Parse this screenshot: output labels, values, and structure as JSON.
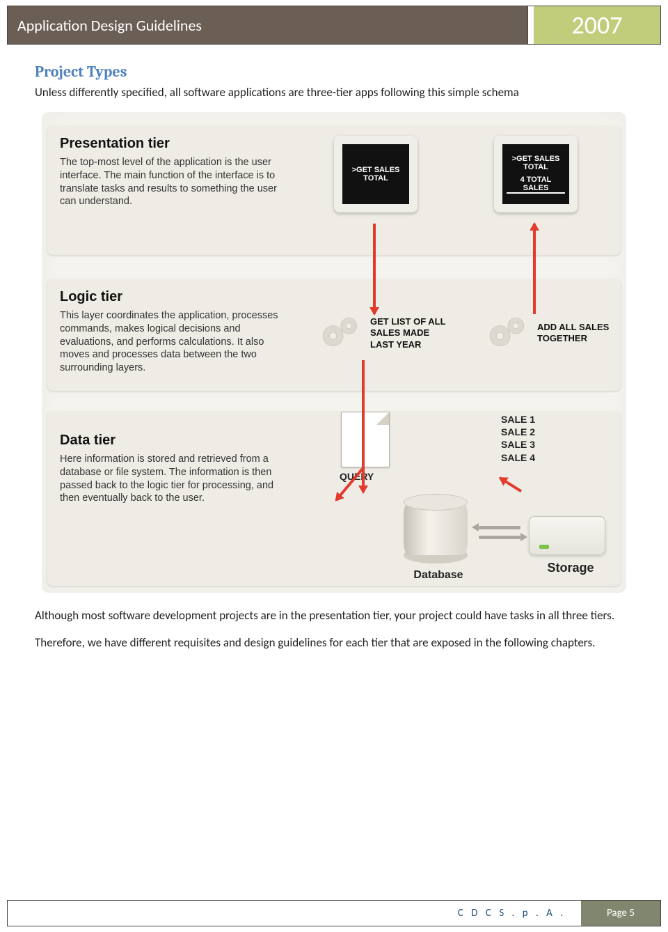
{
  "header": {
    "title": "Application Design Guidelines",
    "year": "2007"
  },
  "section": {
    "title": "Project Types",
    "intro": "Unless differently specified, all software applications are three-tier apps following this simple schema",
    "para2": "Although most software development projects are in the presentation tier, your project could have tasks in all three tiers.",
    "para3": "Therefore, we have different requisites and design guidelines for each tier that are exposed in the following chapters."
  },
  "diagram": {
    "presentation": {
      "title": "Presentation tier",
      "body": "The top-most level of the application is the user interface. The main function of the interface is to translate tasks and results to something the user can understand.",
      "screen1": ">GET SALES TOTAL",
      "screen2a": ">GET SALES TOTAL",
      "screen2b": "4 TOTAL SALES"
    },
    "logic": {
      "title": "Logic tier",
      "body": "This layer coordinates the application, processes commands, makes logical decisions and evaluations, and performs calculations. It also moves and processes data between the two surrounding layers.",
      "gear_left": "GET LIST OF ALL SALES MADE LAST YEAR",
      "gear_right": "ADD ALL SALES TOGETHER"
    },
    "data": {
      "title": "Data tier",
      "body": "Here information is stored and retrieved from a database or file system. The information is then passed back to the logic tier for processing, and then eventually back to the user.",
      "query_label": "QUERY",
      "sales": [
        "SALE 1",
        "SALE 2",
        "SALE 3",
        "SALE 4"
      ],
      "db_label": "Database",
      "storage_label": "Storage"
    }
  },
  "footer": {
    "company": "C D C   S . p . A .",
    "page": "Page 5"
  }
}
